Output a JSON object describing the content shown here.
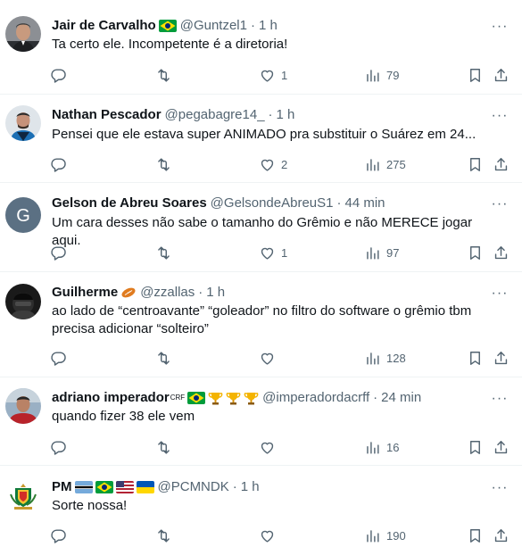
{
  "tweets": [
    {
      "name": "Jair de Carvalho",
      "handle": "@Guntzel1",
      "separator": "·",
      "time": "1 h",
      "text": "Ta certo ele. Incompetente é a diretoria!",
      "likes": "1",
      "views": "79",
      "avatar_icon": "avatar-man-suit"
    },
    {
      "name": "Nathan Pescador",
      "handle": "@pegabagre14_",
      "separator": "·",
      "time": "1 h",
      "text": "Pensei que ele estava super ANIMADO pra substituir o Suárez em 24...",
      "likes": "2",
      "views": "275",
      "avatar_icon": "avatar-man-blue-jersey"
    },
    {
      "name": "Gelson de Abreu Soares",
      "handle": "@GelsondeAbreuS1",
      "separator": "·",
      "time": "44 min",
      "text": "Um cara desses não sabe o tamanho do Grêmio e não MERECE jogar aqui.",
      "likes": "1",
      "views": "97",
      "avatar_letter": "G",
      "avatar_color": "#5b7083"
    },
    {
      "name": "Guilherme",
      "handle": "@zzallas",
      "separator": "·",
      "time": "1 h",
      "text_line1": "ao lado de “centroavante” “goleador” no filtro do software o grêmio tbm",
      "text_line2": "precisa adicionar “solteiro”",
      "likes": "",
      "views": "128",
      "name_emoji": "rugby-ball-icon"
    },
    {
      "name": "adriano imperador",
      "name_sup": "CRF",
      "handle": "@imperadordacrff",
      "separator": "·",
      "time": "24 min",
      "text": "quando fizer 38 ele vem",
      "likes": "",
      "views": "16",
      "badges": [
        "brazil-flag-icon",
        "trophy-icon",
        "trophy-icon",
        "trophy-icon"
      ]
    },
    {
      "name": "PM",
      "handle": "@PCMNDK",
      "separator": "·",
      "time": "1 h",
      "text": "Sorte nossa!",
      "likes": "",
      "views": "190",
      "badges": [
        "botswana-flag-icon",
        "brazil-flag-icon",
        "usa-flag-icon",
        "ukraine-flag-icon"
      ]
    }
  ],
  "icons": {
    "reply": "reply-icon",
    "retweet": "retweet-icon",
    "like": "heart-icon",
    "views": "views-icon",
    "bookmark": "bookmark-icon",
    "share": "share-icon",
    "more": "more-icon"
  },
  "colors": {
    "text": "#0f1419",
    "secondary": "#536471",
    "divider": "#eff3f4",
    "brazil_green": "#009c3b",
    "brazil_yellow": "#ffdf00",
    "trophy_gold": "#f4b400"
  },
  "more_glyph": "···"
}
